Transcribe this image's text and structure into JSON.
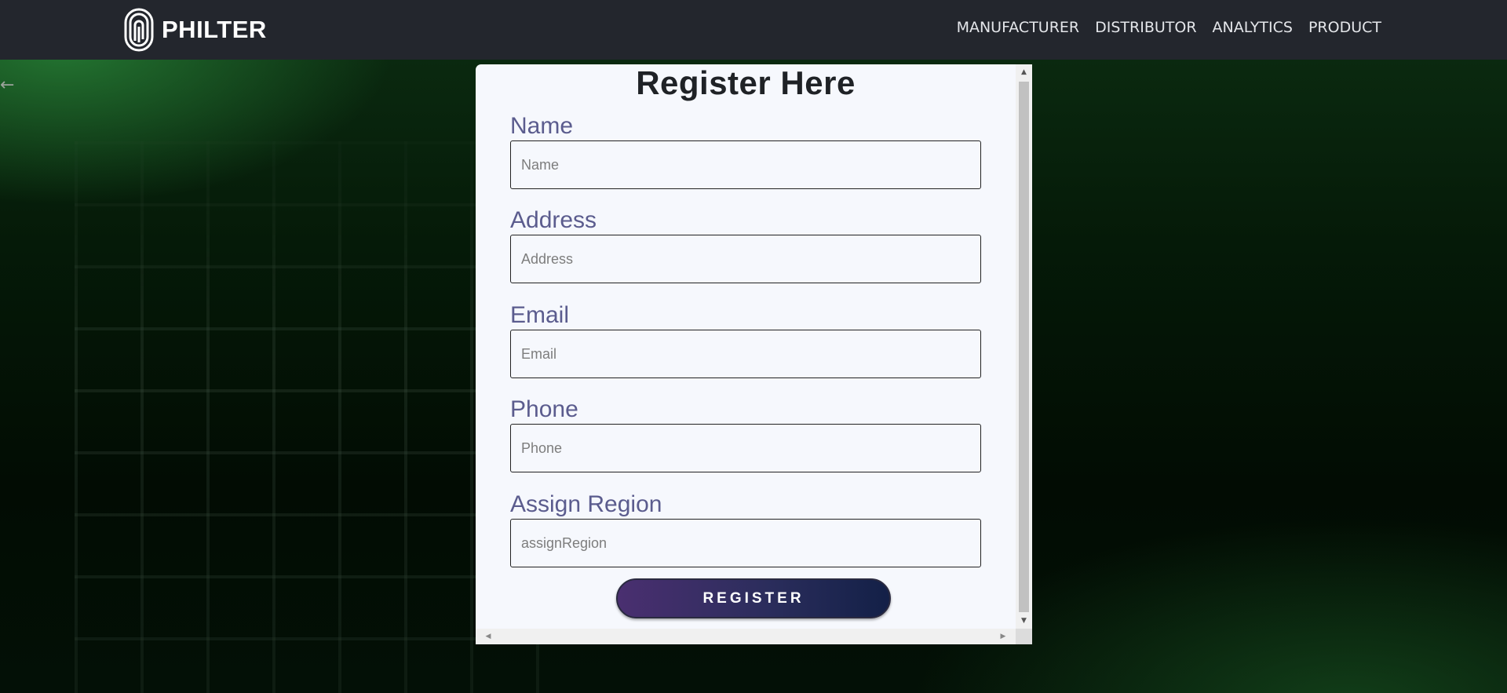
{
  "navbar": {
    "brand": "PHILTER",
    "links": [
      "MANUFACTURER",
      "DISTRIBUTOR",
      "ANALYTICS",
      "PRODUCT"
    ]
  },
  "back": {
    "icon": "left-arrow-icon",
    "glyph": "←"
  },
  "form": {
    "title": "Register Here",
    "fields": [
      {
        "label": "Name",
        "placeholder": "Name",
        "value": ""
      },
      {
        "label": "Address",
        "placeholder": "Address",
        "value": ""
      },
      {
        "label": "Email",
        "placeholder": "Email",
        "value": ""
      },
      {
        "label": "Phone",
        "placeholder": "Phone",
        "value": ""
      },
      {
        "label": "Assign Region",
        "placeholder": "assignRegion",
        "value": ""
      }
    ],
    "submit_label": "REGISTER"
  },
  "colors": {
    "navbar_bg": "#23262d",
    "label_color": "#5b5c8e",
    "button_gradient_start": "#4a2f70",
    "button_gradient_end": "#132047"
  }
}
